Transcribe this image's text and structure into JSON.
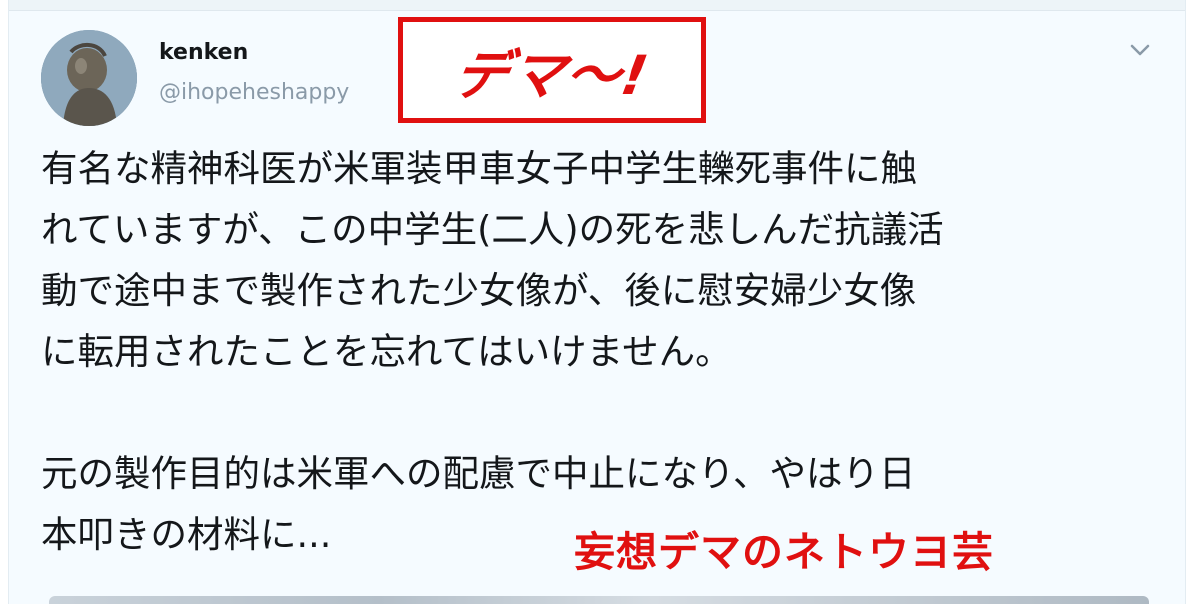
{
  "tweet": {
    "author_name": "kenken",
    "author_handle": "@ihopeheshappy",
    "body": "有名な精神科医が米軍装甲車女子中学生轢死事件に触\nれていますが、この中学生(二人)の死を悲しんだ抗議活\n動で途中まで製作された少女像が、後に慰安婦少女像\nに転用されたことを忘れてはいけません。\n\n元の製作目的は米軍への配慮で中止になり、やはり日\n本叩きの材料に..."
  },
  "overlays": {
    "box_label": "デマ～!",
    "annotation": "妄想デマのネトウヨ芸",
    "accent_color": "#e01010"
  },
  "icons": {
    "avatar": "profile-photo",
    "menu": "chevron-down-icon"
  }
}
